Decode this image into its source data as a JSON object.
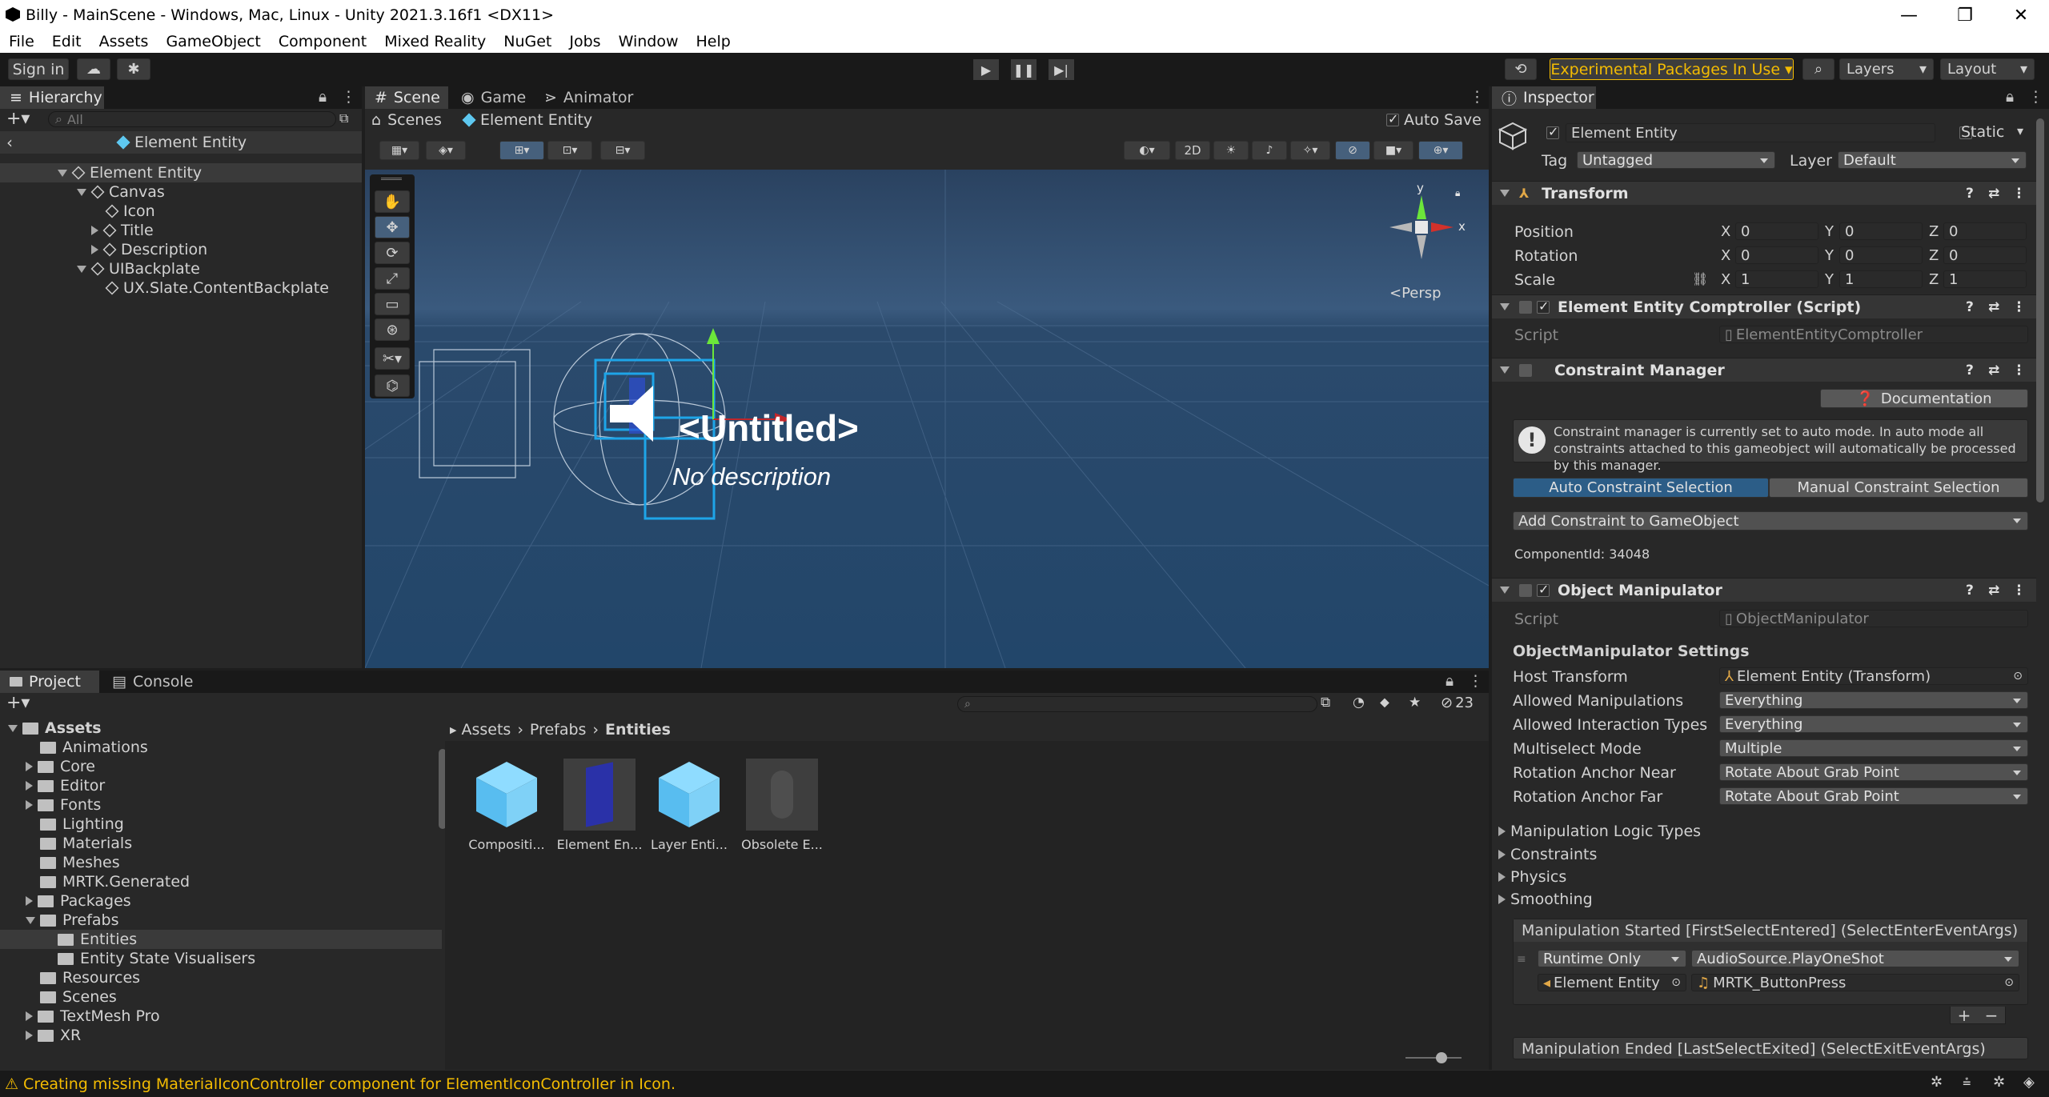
{
  "window": {
    "title": "Billy - MainScene - Windows, Mac, Linux - Unity 2021.3.16f1 <DX11>"
  },
  "menu": [
    "File",
    "Edit",
    "Assets",
    "GameObject",
    "Component",
    "Mixed Reality",
    "NuGet",
    "Jobs",
    "Window",
    "Help"
  ],
  "toolbar": {
    "sign_in": "Sign in",
    "experimental": "Experimental Packages In Use",
    "layers": "Layers",
    "layout": "Layout"
  },
  "hierarchy": {
    "tab": "Hierarchy",
    "search_placeholder": "All",
    "scene_header": "Element Entity",
    "items": [
      {
        "label": "Element Entity"
      },
      {
        "label": "Canvas"
      },
      {
        "label": "Icon"
      },
      {
        "label": "Title"
      },
      {
        "label": "Description"
      },
      {
        "label": "UIBackplate"
      },
      {
        "label": "UX.Slate.ContentBackplate"
      }
    ]
  },
  "scene": {
    "tabs": [
      "Scene",
      "Game",
      "Animator"
    ],
    "breadcrumb_root": "Scenes",
    "breadcrumb_current": "Element Entity",
    "auto_save": "Auto Save",
    "mode_2d": "2D",
    "persp": "<Persp",
    "gizmo_y": "y",
    "gizmo_x": "x",
    "untitled": "<Untitled>",
    "no_description": "No description"
  },
  "project": {
    "tabs": [
      "Project",
      "Console"
    ],
    "hidden_count": "23",
    "breadcrumb": [
      "Assets",
      "Prefabs",
      "Entities"
    ],
    "tree": [
      {
        "label": "Assets",
        "level": 0,
        "open": true
      },
      {
        "label": "Animations",
        "level": 1
      },
      {
        "label": "Core",
        "level": 1,
        "arrow": true
      },
      {
        "label": "Editor",
        "level": 1,
        "arrow": true
      },
      {
        "label": "Fonts",
        "level": 1,
        "arrow": true
      },
      {
        "label": "Lighting",
        "level": 1
      },
      {
        "label": "Materials",
        "level": 1
      },
      {
        "label": "Meshes",
        "level": 1
      },
      {
        "label": "MRTK.Generated",
        "level": 1
      },
      {
        "label": "Packages",
        "level": 1,
        "arrow": true
      },
      {
        "label": "Prefabs",
        "level": 1,
        "open": true
      },
      {
        "label": "Entities",
        "level": 2,
        "selected": true
      },
      {
        "label": "Entity State Visualisers",
        "level": 2
      },
      {
        "label": "Resources",
        "level": 1
      },
      {
        "label": "Scenes",
        "level": 1
      },
      {
        "label": "TextMesh Pro",
        "level": 1,
        "arrow": true
      },
      {
        "label": "XR",
        "level": 1,
        "arrow": true
      }
    ],
    "assets": [
      "Compositi...",
      "Element En...",
      "Layer Enti...",
      "Obsolete E..."
    ]
  },
  "inspector": {
    "tab": "Inspector",
    "object_name": "Element Entity",
    "static": "Static",
    "tag_label": "Tag",
    "tag_value": "Untagged",
    "layer_label": "Layer",
    "layer_value": "Default",
    "transform": {
      "title": "Transform",
      "rows": [
        {
          "label": "Position",
          "x": "0",
          "y": "0",
          "z": "0"
        },
        {
          "label": "Rotation",
          "x": "0",
          "y": "0",
          "z": "0"
        },
        {
          "label": "Scale",
          "x": "1",
          "y": "1",
          "z": "1"
        }
      ],
      "axis": [
        "X",
        "Y",
        "Z"
      ]
    },
    "comptroller": {
      "title": "Element Entity Comptroller (Script)",
      "script_label": "Script",
      "script_value": "ElementEntityComptroller"
    },
    "constraint_manager": {
      "title": "Constraint Manager",
      "documentation": "Documentation",
      "info": "Constraint manager is currently set to auto mode. In auto mode all constraints attached to this gameobject will automatically be processed by this manager.",
      "auto": "Auto Constraint Selection",
      "manual": "Manual Constraint Selection",
      "add": "Add Constraint to GameObject",
      "component_id": "ComponentId: 34048"
    },
    "object_manipulator": {
      "title": "Object Manipulator",
      "script_label": "Script",
      "script_value": "ObjectManipulator",
      "settings_header": "ObjectManipulator Settings",
      "rows": [
        {
          "label": "Host Transform",
          "value": "Element Entity (Transform)"
        },
        {
          "label": "Allowed Manipulations",
          "value": "Everything"
        },
        {
          "label": "Allowed Interaction Types",
          "value": "Everything"
        },
        {
          "label": "Multiselect Mode",
          "value": "Multiple"
        },
        {
          "label": "Rotation Anchor Near",
          "value": "Rotate About Grab Point"
        },
        {
          "label": "Rotation Anchor Far",
          "value": "Rotate About Grab Point"
        }
      ],
      "foldouts": [
        "Manipulation Logic Types",
        "Constraints",
        "Physics",
        "Smoothing"
      ],
      "event_started": "Manipulation Started [FirstSelectEntered] (SelectEnterEventArgs)",
      "runtime": "Runtime Only",
      "method": "AudioSource.PlayOneShot",
      "target": "Element Entity",
      "clip": "MRTK_ButtonPress",
      "event_ended": "Manipulation Ended [LastSelectExited] (SelectExitEventArgs)"
    }
  },
  "status": {
    "message": "Creating missing MaterialIconController component for ElementIconController in Icon."
  },
  "colors": {
    "accent": "#2c5d87",
    "warning": "#f4bc02",
    "transform_icon": "#e2a847"
  }
}
